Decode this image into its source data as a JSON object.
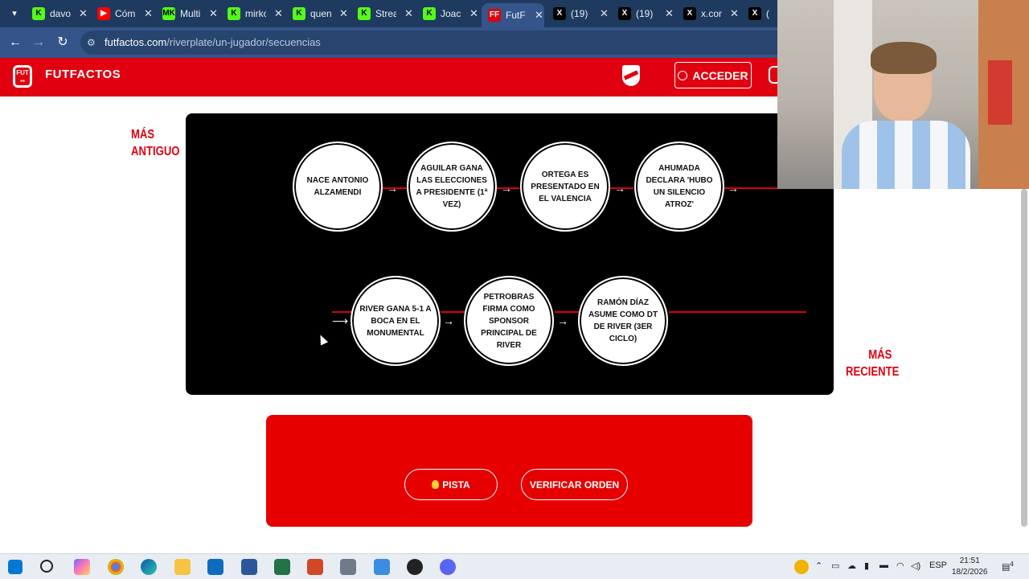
{
  "browser": {
    "tabs": [
      {
        "label": "davo",
        "icon": "kick-icon",
        "color": "#53fc18"
      },
      {
        "label": "Cóm",
        "icon": "youtube-icon",
        "color": "#ff0000"
      },
      {
        "label": "Multi",
        "icon": "multikick-icon",
        "color": "#53fc18"
      },
      {
        "label": "mirko",
        "icon": "kick-icon",
        "color": "#53fc18"
      },
      {
        "label": "quen",
        "icon": "kick-icon",
        "color": "#53fc18"
      },
      {
        "label": "Strea",
        "icon": "kick-icon",
        "color": "#53fc18"
      },
      {
        "label": "Joac",
        "icon": "kick-icon",
        "color": "#53fc18"
      },
      {
        "label": "FutF",
        "icon": "futfactos-icon",
        "color": "#e0000f",
        "active": true
      },
      {
        "label": "(19)",
        "icon": "x-icon",
        "color": "#000000"
      },
      {
        "label": "(19)",
        "icon": "x-icon",
        "color": "#000000"
      },
      {
        "label": "x.con",
        "icon": "x-icon",
        "color": "#000000"
      },
      {
        "label": "(",
        "icon": "x-icon",
        "color": "#000000"
      }
    ],
    "url_host": "futfactos.com",
    "url_path": "/riverplate/un-jugador/secuencias"
  },
  "site": {
    "brand": "FUTFACTOS",
    "login_label": "ACCEDER",
    "accent": "#e0000f"
  },
  "labels": {
    "oldest": "MÁS ANTIGUO",
    "newest": "MÁS RECIENTE"
  },
  "sequence": {
    "row1": [
      "NACE ANTONIO ALZAMENDI",
      "AGUILAR GANA LAS ELECCIONES A PRESIDENTE (1ª VEZ)",
      "ORTEGA ES PRESENTADO EN EL VALENCIA",
      "AHUMADA DECLARA 'HUBO UN SILENCIO ATROZ'"
    ],
    "row2": [
      "RIVER GANA 5-1 A BOCA EN EL MONUMENTAL",
      "PETROBRAS FIRMA COMO SPONSOR PRINCIPAL DE RIVER",
      "RAMÓN DÍAZ ASUME COMO DT DE RIVER (3ER CICLO)"
    ]
  },
  "actions": {
    "hint_label": "PISTA",
    "verify_label": "VERIFICAR ORDEN"
  },
  "taskbar": {
    "lang": "ESP",
    "time": "21:51",
    "date": "18/2/2026",
    "notifications": "4"
  }
}
